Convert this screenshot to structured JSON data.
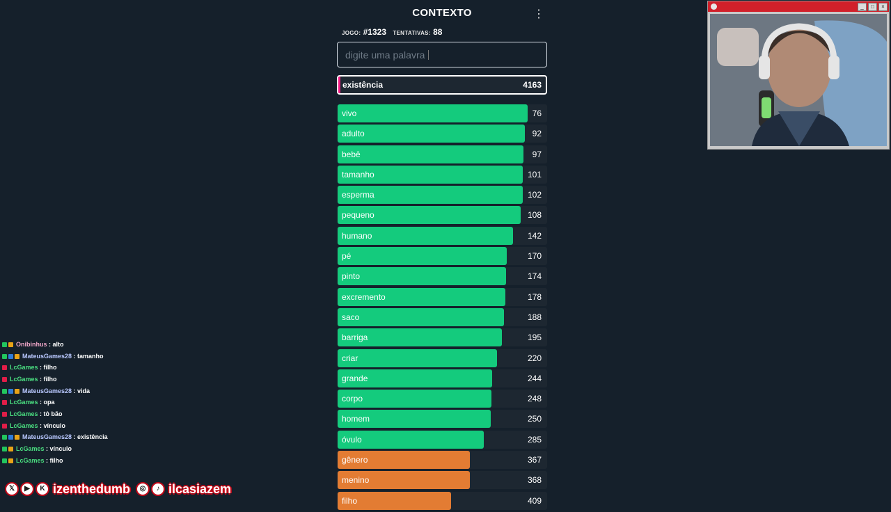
{
  "game": {
    "title": "CONTEXTO",
    "game_label": "JOGO:",
    "game_number": "#1323",
    "attempts_label": "TENTATIVAS:",
    "attempts": "88",
    "input_placeholder": "digite uma palavra",
    "last_guess": {
      "word": "existência",
      "rank": "4163"
    },
    "colors": {
      "green": "#14cb7d",
      "orange": "#e37c33",
      "pink": "#f01a82",
      "row_bg": "#1d2731"
    },
    "guesses": [
      {
        "word": "vivo",
        "rank": 76,
        "fill": 0.905,
        "color": "green"
      },
      {
        "word": "adulto",
        "rank": 92,
        "fill": 0.89,
        "color": "green"
      },
      {
        "word": "bebê",
        "rank": 97,
        "fill": 0.885,
        "color": "green"
      },
      {
        "word": "tamanho",
        "rank": 101,
        "fill": 0.88,
        "color": "green"
      },
      {
        "word": "esperma",
        "rank": 102,
        "fill": 0.88,
        "color": "green"
      },
      {
        "word": "pequeno",
        "rank": 108,
        "fill": 0.87,
        "color": "green"
      },
      {
        "word": "humano",
        "rank": 142,
        "fill": 0.835,
        "color": "green"
      },
      {
        "word": "pé",
        "rank": 170,
        "fill": 0.805,
        "color": "green"
      },
      {
        "word": "pinto",
        "rank": 174,
        "fill": 0.8,
        "color": "green"
      },
      {
        "word": "excremento",
        "rank": 178,
        "fill": 0.798,
        "color": "green"
      },
      {
        "word": "saco",
        "rank": 188,
        "fill": 0.79,
        "color": "green"
      },
      {
        "word": "barriga",
        "rank": 195,
        "fill": 0.782,
        "color": "green"
      },
      {
        "word": "criar",
        "rank": 220,
        "fill": 0.757,
        "color": "green"
      },
      {
        "word": "grande",
        "rank": 244,
        "fill": 0.735,
        "color": "green"
      },
      {
        "word": "corpo",
        "rank": 248,
        "fill": 0.732,
        "color": "green"
      },
      {
        "word": "homem",
        "rank": 250,
        "fill": 0.73,
        "color": "green"
      },
      {
        "word": "óvulo",
        "rank": 285,
        "fill": 0.695,
        "color": "green"
      },
      {
        "word": "gênero",
        "rank": 367,
        "fill": 0.63,
        "color": "orange"
      },
      {
        "word": "menino",
        "rank": 368,
        "fill": 0.63,
        "color": "orange"
      },
      {
        "word": "filho",
        "rank": 409,
        "fill": 0.54,
        "color": "orange"
      }
    ]
  },
  "webcam": {
    "buttons": [
      "_",
      "□",
      "×"
    ]
  },
  "chat": {
    "separator": " : ",
    "messages": [
      {
        "user": "Onibinhus",
        "text": "alto",
        "user_color": "#f0a6c8",
        "badges": [
          "#22c55e",
          "#e8a317"
        ]
      },
      {
        "user": "MateusGames28",
        "text": "tamanho",
        "user_color": "#b9c8ff",
        "badges": [
          "#22c55e",
          "#2f7bd8",
          "#e8a317"
        ]
      },
      {
        "user": "LcGames",
        "text": "filho",
        "user_color": "#4ade80",
        "badges": [
          "#e11d48"
        ]
      },
      {
        "user": "LcGames",
        "text": "filho",
        "user_color": "#4ade80",
        "badges": [
          "#e11d48"
        ]
      },
      {
        "user": "MateusGames28",
        "text": "vida",
        "user_color": "#b9c8ff",
        "badges": [
          "#22c55e",
          "#2f7bd8",
          "#e8a317"
        ]
      },
      {
        "user": "LcGames",
        "text": "opa",
        "user_color": "#4ade80",
        "badges": [
          "#e11d48"
        ]
      },
      {
        "user": "LcGames",
        "text": "tô bão",
        "user_color": "#4ade80",
        "badges": [
          "#e11d48"
        ]
      },
      {
        "user": "LcGames",
        "text": "vínculo",
        "user_color": "#4ade80",
        "badges": [
          "#e11d48"
        ]
      },
      {
        "user": "MateusGames28",
        "text": "existência",
        "user_color": "#b9c8ff",
        "badges": [
          "#22c55e",
          "#2f7bd8",
          "#e8a317"
        ]
      },
      {
        "user": "LcGames",
        "text": "vínculo",
        "user_color": "#4ade80",
        "badges": [
          "#22c55e",
          "#e8a317"
        ]
      },
      {
        "user": "LcGames",
        "text": "filho",
        "user_color": "#4ade80",
        "badges": [
          "#22c55e",
          "#e8a317"
        ]
      }
    ]
  },
  "socials": {
    "handle_1": "izenthedumb",
    "handle_2": "ilcasiazem",
    "icons": [
      "x-icon",
      "youtube-icon",
      "kick-icon",
      "instagram-icon",
      "tiktok-icon"
    ]
  }
}
